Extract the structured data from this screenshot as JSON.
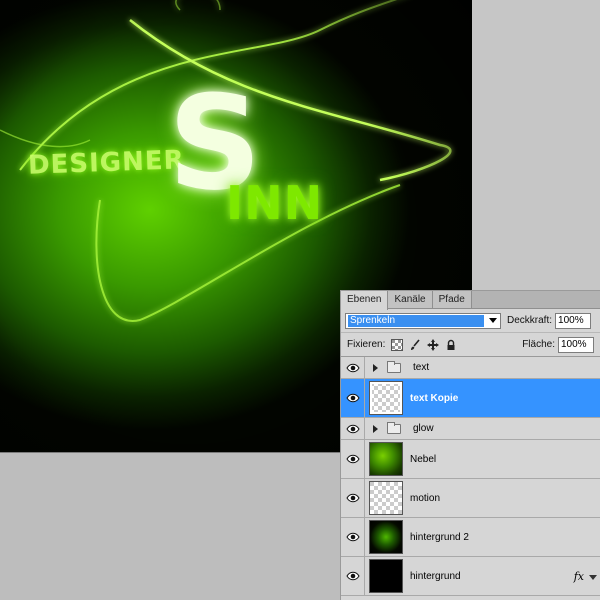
{
  "canvas": {
    "art_line1": "DESIGNER",
    "art_line2": "S",
    "art_line3": "INN"
  },
  "panel": {
    "tabs": [
      {
        "label": "Ebenen",
        "active": true
      },
      {
        "label": "Kanäle",
        "active": false
      },
      {
        "label": "Pfade",
        "active": false
      }
    ],
    "blend_mode": "Sprenkeln",
    "opacity_label": "Deckkraft:",
    "opacity_value": "100%",
    "lock_label": "Fixieren:",
    "fill_label": "Fläche:",
    "fill_value": "100%",
    "layers": [
      {
        "name": "text",
        "type": "group",
        "selected": false
      },
      {
        "name": "text Kopie",
        "type": "layer",
        "thumb": "checker",
        "selected": true
      },
      {
        "name": "glow",
        "type": "group",
        "selected": false
      },
      {
        "name": "Nebel",
        "type": "layer",
        "thumb": "nebel",
        "selected": false
      },
      {
        "name": "motion",
        "type": "layer",
        "thumb": "checker",
        "selected": false
      },
      {
        "name": "hintergrund 2",
        "type": "layer",
        "thumb": "hg2",
        "selected": false
      },
      {
        "name": "hintergrund",
        "type": "layer",
        "thumb": "hg",
        "selected": false,
        "fx": "fx"
      }
    ]
  },
  "colors": {
    "selection": "#3593ff",
    "glow_green": "#9bff2a"
  }
}
